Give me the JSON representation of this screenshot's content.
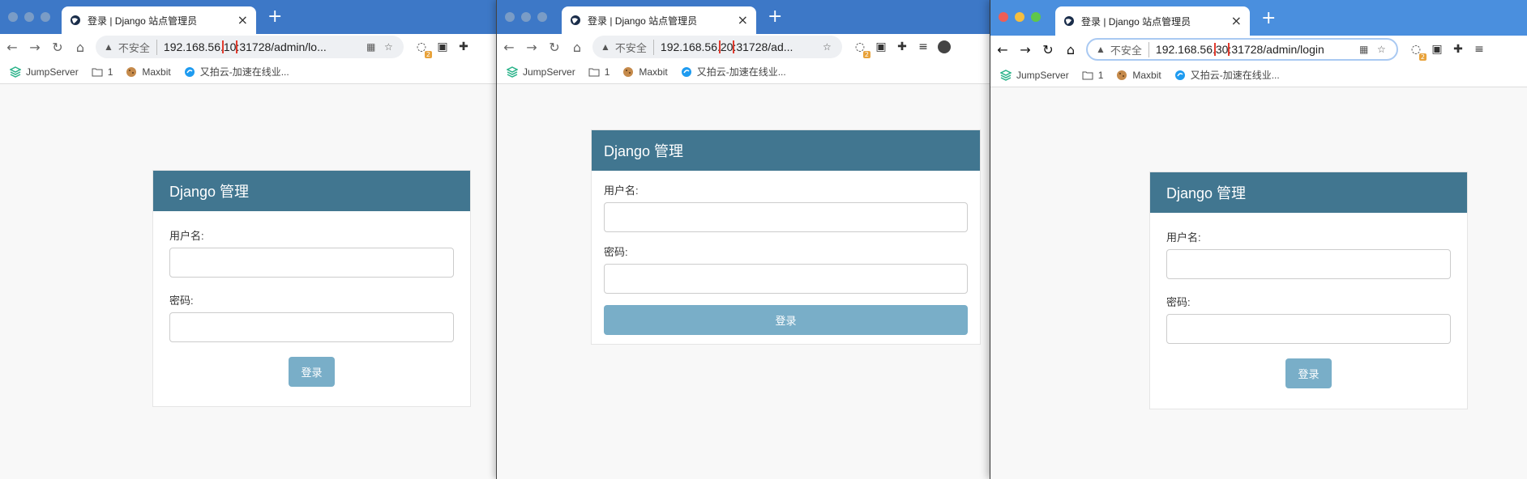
{
  "windows": [
    {
      "tab_title": "登录 | Django 站点管理员",
      "insecure": "不安全",
      "url_pre": "192.168.56.",
      "url_hl": "10",
      "url_post": ":31728/admin/lo...",
      "bookmarks": [
        "JumpServer",
        "1",
        "Maxbit",
        "又拍云-加速在线业..."
      ],
      "card_title": "Django 管理",
      "username_label": "用户名:",
      "password_label": "密码:",
      "login_button": "登录",
      "badge": "2"
    },
    {
      "tab_title": "登录 | Django 站点管理员",
      "insecure": "不安全",
      "url_pre": "192.168.56.",
      "url_hl": "20",
      "url_post": ":31728/ad...",
      "bookmarks": [
        "JumpServer",
        "1",
        "Maxbit",
        "又拍云-加速在线业..."
      ],
      "card_title": "Django 管理",
      "username_label": "用户名:",
      "password_label": "密码:",
      "login_button": "登录",
      "badge": "2"
    },
    {
      "tab_title": "登录 | Django 站点管理员",
      "insecure": "不安全",
      "url_pre": "192.168.56.",
      "url_hl": "30",
      "url_post": ":31728/admin/login",
      "bookmarks": [
        "JumpServer",
        "1",
        "Maxbit",
        "又拍云-加速在线业..."
      ],
      "card_title": "Django 管理",
      "username_label": "用户名:",
      "password_label": "密码:",
      "login_button": "登录",
      "badge": "2"
    }
  ],
  "colors": {
    "django_header": "#417690",
    "login_button": "#79aec8",
    "highlight_box": "#e23b2e"
  }
}
